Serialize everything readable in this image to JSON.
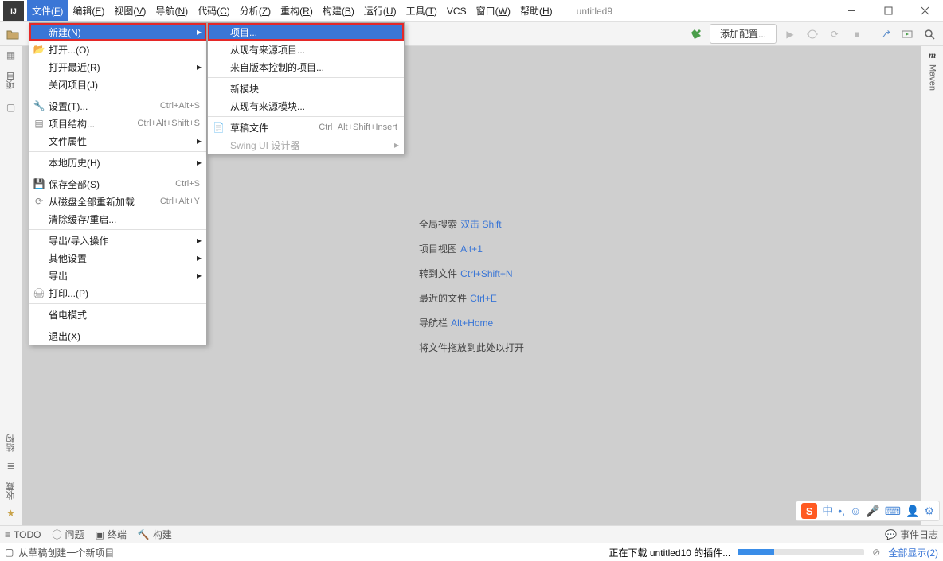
{
  "app": {
    "project_title": "untitled9"
  },
  "menus": [
    {
      "label": "文件",
      "u": "F",
      "active": true
    },
    {
      "label": "编辑",
      "u": "E"
    },
    {
      "label": "视图",
      "u": "V"
    },
    {
      "label": "导航",
      "u": "N"
    },
    {
      "label": "代码",
      "u": "C"
    },
    {
      "label": "分析",
      "u": "Z"
    },
    {
      "label": "重构",
      "u": "R"
    },
    {
      "label": "构建",
      "u": "B"
    },
    {
      "label": "运行",
      "u": "U"
    },
    {
      "label": "工具",
      "u": "T"
    },
    {
      "label": "VCS",
      "u": ""
    },
    {
      "label": "窗口",
      "u": "W"
    },
    {
      "label": "帮助",
      "u": "H"
    }
  ],
  "toolbar": {
    "add_config": "添加配置..."
  },
  "left_gutter": {
    "project": "项目",
    "structure": "结构",
    "favorites": "收藏"
  },
  "right_gutter": {
    "maven": "Maven"
  },
  "file_menu": {
    "new": "新建(N)",
    "open": "打开...(O)",
    "open_recent": "打开最近(R)",
    "close_project": "关闭项目(J)",
    "settings": {
      "label": "设置(T)...",
      "shortcut": "Ctrl+Alt+S"
    },
    "project_structure": {
      "label": "项目结构...",
      "shortcut": "Ctrl+Alt+Shift+S"
    },
    "file_properties": "文件属性",
    "local_history": "本地历史(H)",
    "save_all": {
      "label": "保存全部(S)",
      "shortcut": "Ctrl+S"
    },
    "reload_from_disk": {
      "label": "从磁盘全部重新加载",
      "shortcut": "Ctrl+Alt+Y"
    },
    "clear_cache": "清除缓存/重启...",
    "export_import": "导出/导入操作",
    "other_settings": "其他设置",
    "export": "导出",
    "print": "打印...(P)",
    "power_save": "省电模式",
    "exit": "退出(X)"
  },
  "new_submenu": {
    "project": "项目...",
    "from_sources": "从现有来源项目...",
    "from_vcs": "来自版本控制的项目...",
    "new_module": "新模块",
    "module_from_sources": "从现有来源模块...",
    "scratch": {
      "label": "草稿文件",
      "shortcut": "Ctrl+Alt+Shift+Insert"
    },
    "swing_ui": "Swing UI 设计器"
  },
  "welcome": {
    "l1": {
      "text": "全局搜索",
      "key": "双击 Shift"
    },
    "l2": {
      "text": "项目视图",
      "key": "Alt+1"
    },
    "l3": {
      "text": "转到文件",
      "key": "Ctrl+Shift+N"
    },
    "l4": {
      "text": "最近的文件",
      "key": "Ctrl+E"
    },
    "l5": {
      "text": "导航栏",
      "key": "Alt+Home"
    },
    "l6": {
      "text": "将文件拖放到此处以打开"
    }
  },
  "bottom_tools": {
    "todo": "TODO",
    "problems": "问题",
    "terminal": "终端",
    "build": "构建",
    "event_log": "事件日志"
  },
  "statusbar": {
    "left": "从草稿创建一个新项目",
    "downloading": "正在下载 untitled10 的插件...",
    "show_all": "全部显示(2)"
  },
  "ime": {
    "lang": "中"
  }
}
